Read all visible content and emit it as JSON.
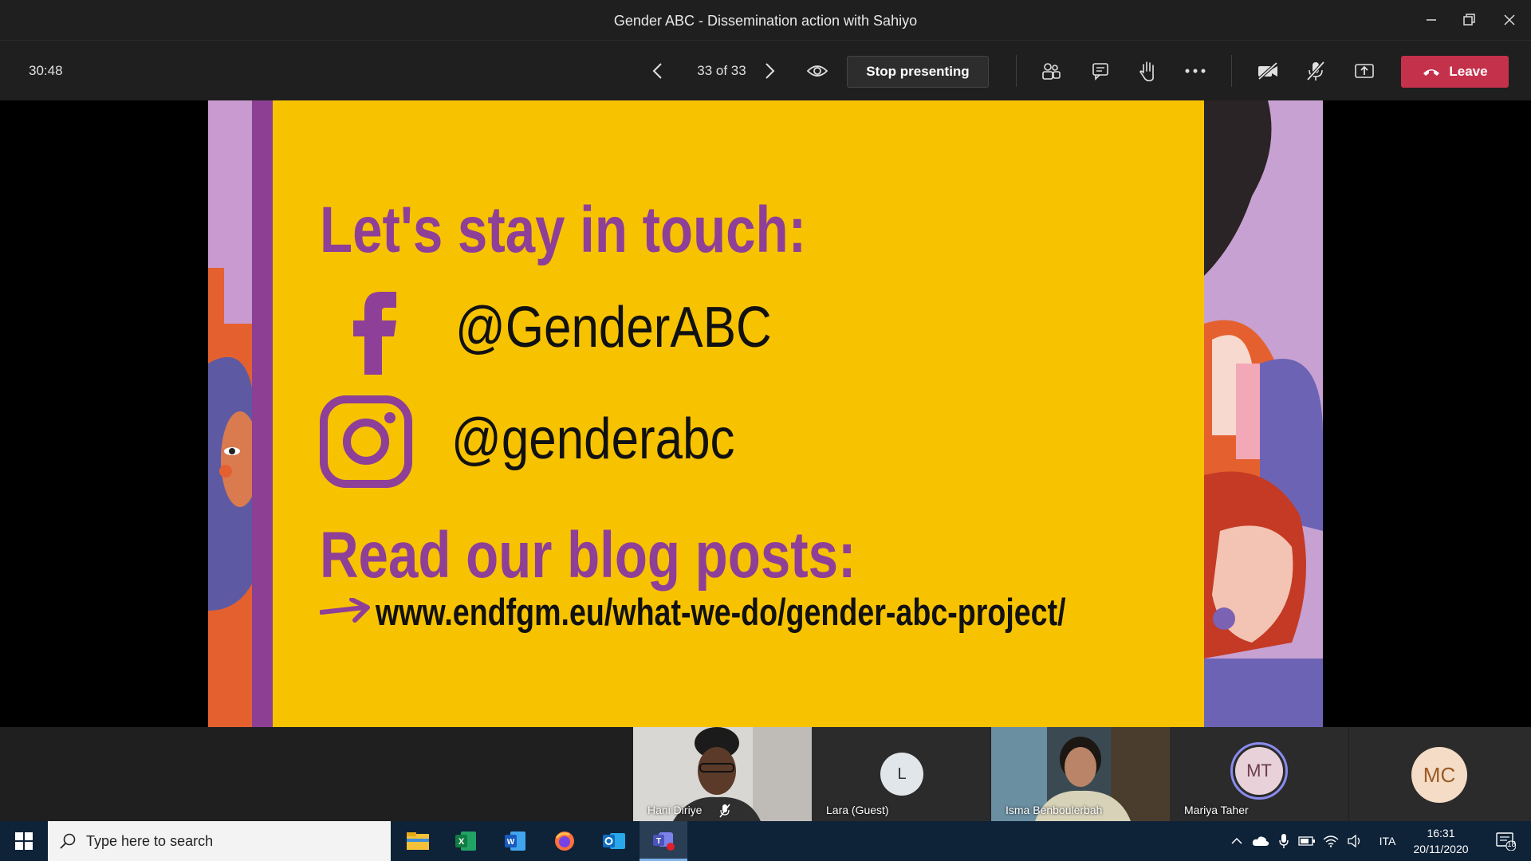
{
  "window": {
    "title": "Gender ABC - Dissemination action with Sahiyo"
  },
  "toolbar": {
    "timer": "30:48",
    "slide_counter": "33 of 33",
    "stop_presenting_label": "Stop presenting",
    "leave_label": "Leave",
    "icons": [
      "chevron-left-icon",
      "chevron-right-icon",
      "eye-icon",
      "people-icon",
      "chat-icon",
      "raise-hand-icon",
      "more-icon",
      "camera-off-icon",
      "mic-off-icon",
      "share-screen-icon",
      "phone-hangup-icon"
    ]
  },
  "slide": {
    "heading1": "Let's stay in touch:",
    "facebook_handle": "@GenderABC",
    "instagram_handle": "@genderabc",
    "heading2": "Read our blog posts:",
    "url": "www.endfgm.eu/what-we-do/gender-abc-project/",
    "colors": {
      "background": "#f7c200",
      "accent": "#8e3f97"
    }
  },
  "participants": [
    {
      "name": "Hani Diriye",
      "type": "video",
      "mic_muted": true
    },
    {
      "name": "Lara (Guest)",
      "type": "avatar",
      "initials": "L"
    },
    {
      "name": "Isma Benboulerbah",
      "type": "video"
    },
    {
      "name": "Mariya Taher",
      "type": "avatar",
      "initials": "MT",
      "speaking": true
    },
    {
      "name": "",
      "type": "avatar",
      "initials": "MC"
    }
  ],
  "taskbar": {
    "search_placeholder": "Type here to search",
    "apps": [
      "file-explorer-icon",
      "excel-icon",
      "word-icon",
      "firefox-icon",
      "outlook-icon",
      "teams-icon"
    ],
    "language": "ITA",
    "time": "16:31",
    "date": "20/11/2020",
    "notification_count": "18"
  }
}
